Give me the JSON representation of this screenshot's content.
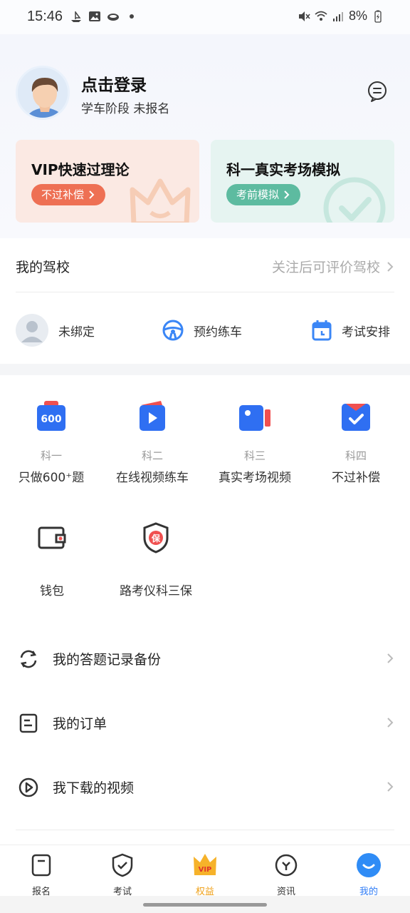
{
  "status_bar": {
    "time": "15:46",
    "battery": "8%",
    "icons_left": [
      "ship-icon",
      "image-icon",
      "cloud-icon",
      "dot-icon"
    ],
    "icons_right": [
      "mute-icon",
      "wifi-icon",
      "signal-icon",
      "battery-icon"
    ]
  },
  "profile": {
    "title": "点击登录",
    "subtitle": "学车阶段 未报名"
  },
  "cards": {
    "vip": {
      "title": "VIP快速过理论",
      "pill": "不过补偿"
    },
    "sim": {
      "title": "科一真实考场模拟",
      "pill": "考前模拟"
    }
  },
  "school": {
    "label": "我的驾校",
    "action": "关注后可评价驾校"
  },
  "quick": [
    {
      "label": "未绑定",
      "icon": "user-placeholder-icon"
    },
    {
      "label": "预约练车",
      "icon": "steering-wheel-icon"
    },
    {
      "label": "考试安排",
      "icon": "calendar-icon"
    }
  ],
  "subjects": [
    {
      "sub": "科一",
      "label": "只做600⁺题",
      "icon": "subject-one-icon",
      "badge": "600"
    },
    {
      "sub": "科二",
      "label": "在线视频练车",
      "icon": "video-play-icon"
    },
    {
      "sub": "科三",
      "label": "真实考场视频",
      "icon": "camera-icon"
    },
    {
      "sub": "科四",
      "label": "不过补偿",
      "icon": "checkmark-envelope-icon"
    }
  ],
  "tools": [
    {
      "label": "钱包",
      "icon": "wallet-icon"
    },
    {
      "label": "路考仪科三保",
      "icon": "shield-bao-icon",
      "badge": "保"
    }
  ],
  "list": [
    {
      "label": "我的答题记录备份",
      "icon": "sync-icon"
    },
    {
      "label": "我的订单",
      "icon": "order-icon"
    },
    {
      "label": "我下载的视频",
      "icon": "play-circle-icon"
    }
  ],
  "nav": [
    {
      "label": "报名",
      "icon": "signup-icon"
    },
    {
      "label": "考试",
      "icon": "exam-shield-icon"
    },
    {
      "label": "权益",
      "icon": "vip-crown-icon",
      "badge": "VIP"
    },
    {
      "label": "资讯",
      "icon": "news-compass-icon"
    },
    {
      "label": "我的",
      "icon": "me-face-icon"
    }
  ],
  "colors": {
    "accent": "#2f7cf6",
    "vip_pill": "#ee7054",
    "sim_pill": "#5dbba0",
    "vip_nav": "#f0a21b"
  }
}
